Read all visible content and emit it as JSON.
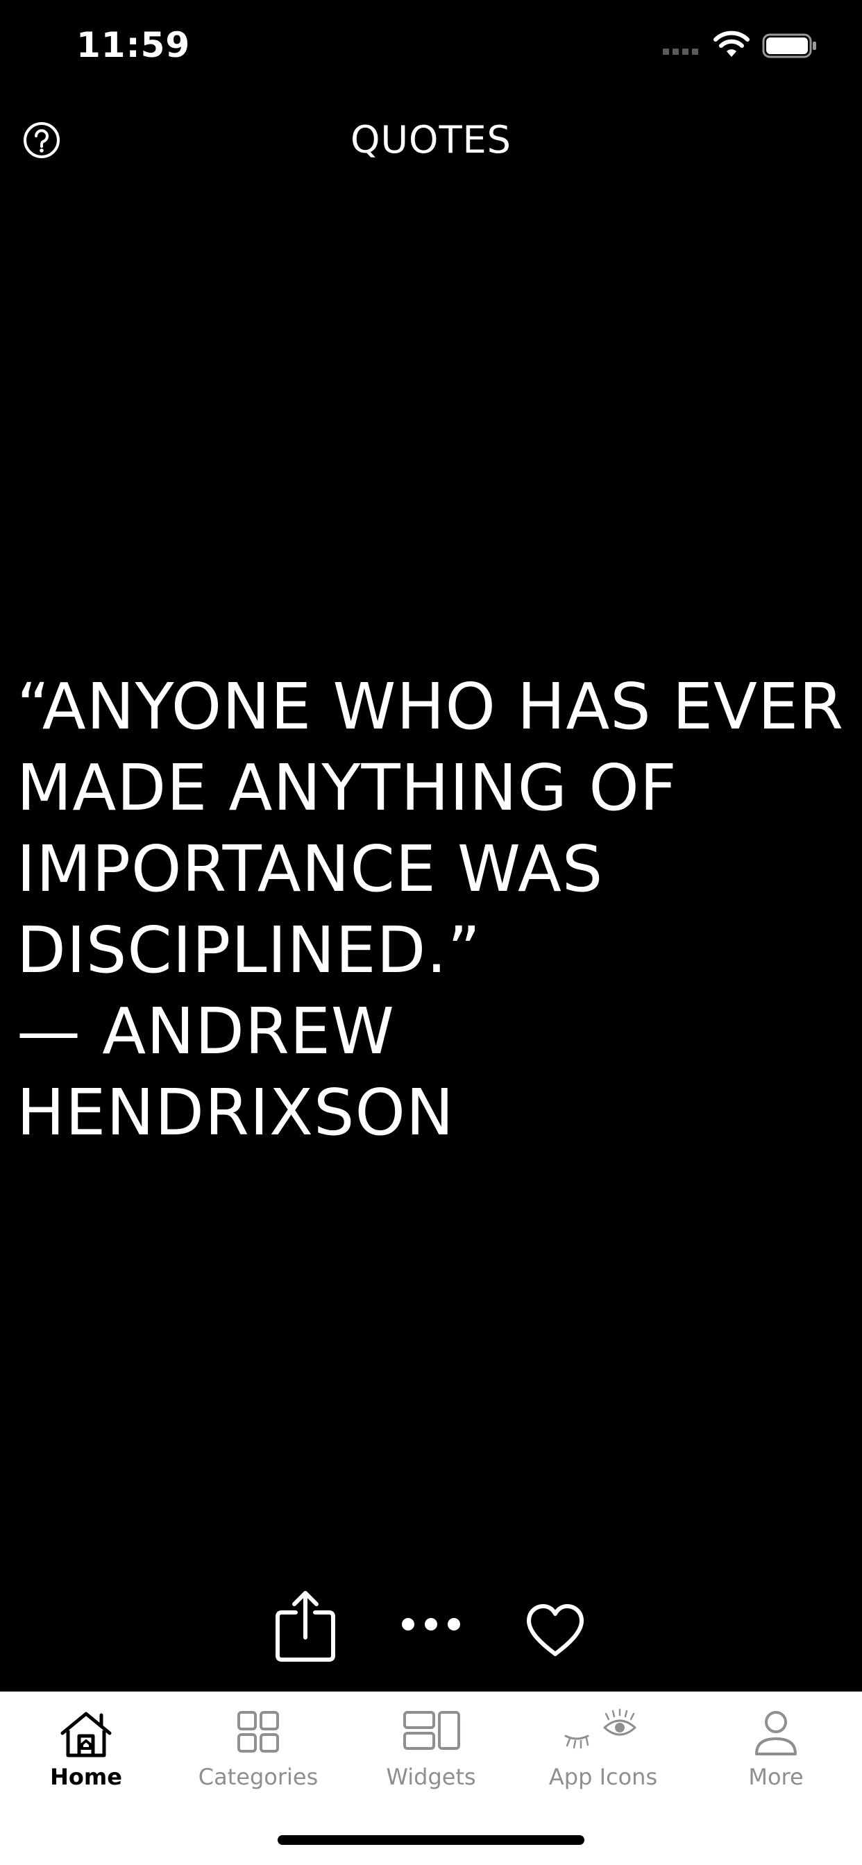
{
  "status_bar": {
    "time": "11:59"
  },
  "header": {
    "title": "QUOTES",
    "help_icon": "question-circle-icon"
  },
  "quote": {
    "text": "“ANYONE WHO HAS EVER MADE ANYTHING OF IMPORTANCE WAS DISCIPLINED.”",
    "author": "— ANDREW HENDRIXSON"
  },
  "actions": [
    {
      "name": "share",
      "icon": "share-icon"
    },
    {
      "name": "more",
      "icon": "ellipsis-icon"
    },
    {
      "name": "like",
      "icon": "heart-icon"
    }
  ],
  "tabs": [
    {
      "label": "Home",
      "icon": "home-icon",
      "active": true
    },
    {
      "label": "Categories",
      "icon": "grid-icon",
      "active": false
    },
    {
      "label": "Widgets",
      "icon": "widgets-icon",
      "active": false
    },
    {
      "label": "App Icons",
      "icon": "eye-icon",
      "active": false
    },
    {
      "label": "More",
      "icon": "person-icon",
      "active": false
    }
  ],
  "colors": {
    "background": "#000000",
    "text": "#ffffff",
    "tab_bar_background": "#ffffff",
    "tab_active": "#000000",
    "tab_inactive": "#8e8e93"
  }
}
